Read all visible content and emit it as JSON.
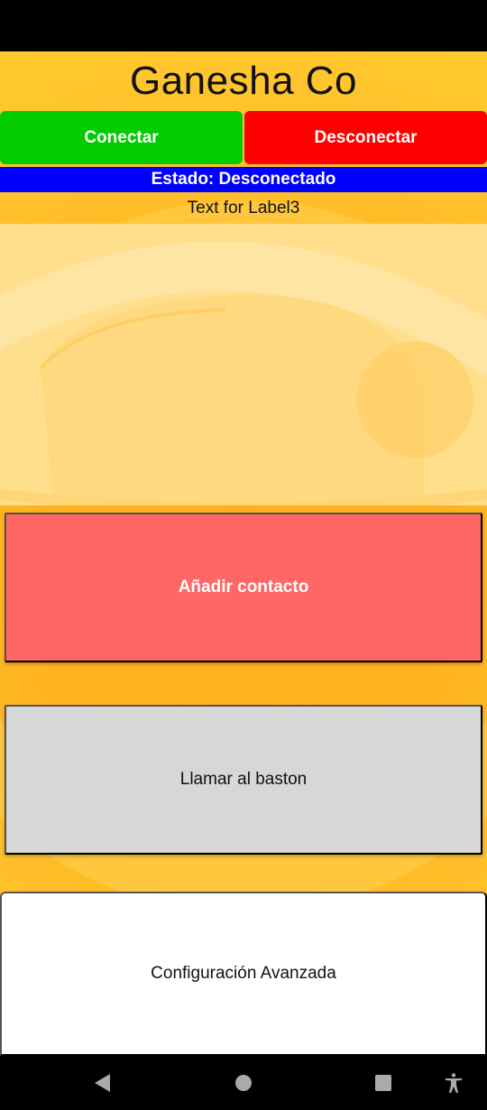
{
  "app": {
    "title": "Ganesha Co",
    "connect_label": "Conectar",
    "disconnect_label": "Desconectar",
    "status_text": "Estado: Desconectado",
    "label3": "Text for Label3",
    "add_contact_label": "Añadir contacto",
    "call_cane_label": "Llamar al baston",
    "advanced_config_label": "Configuración Avanzada"
  },
  "colors": {
    "background": "#ffb820",
    "connect": "#00cc00",
    "disconnect": "#ff0000",
    "status_bar": "#0000ff",
    "add_contact": "#ff6666",
    "call_cane": "#d6d8d6"
  },
  "nav": {
    "icons": [
      "back-icon",
      "home-icon",
      "recents-icon",
      "accessibility-icon"
    ]
  }
}
